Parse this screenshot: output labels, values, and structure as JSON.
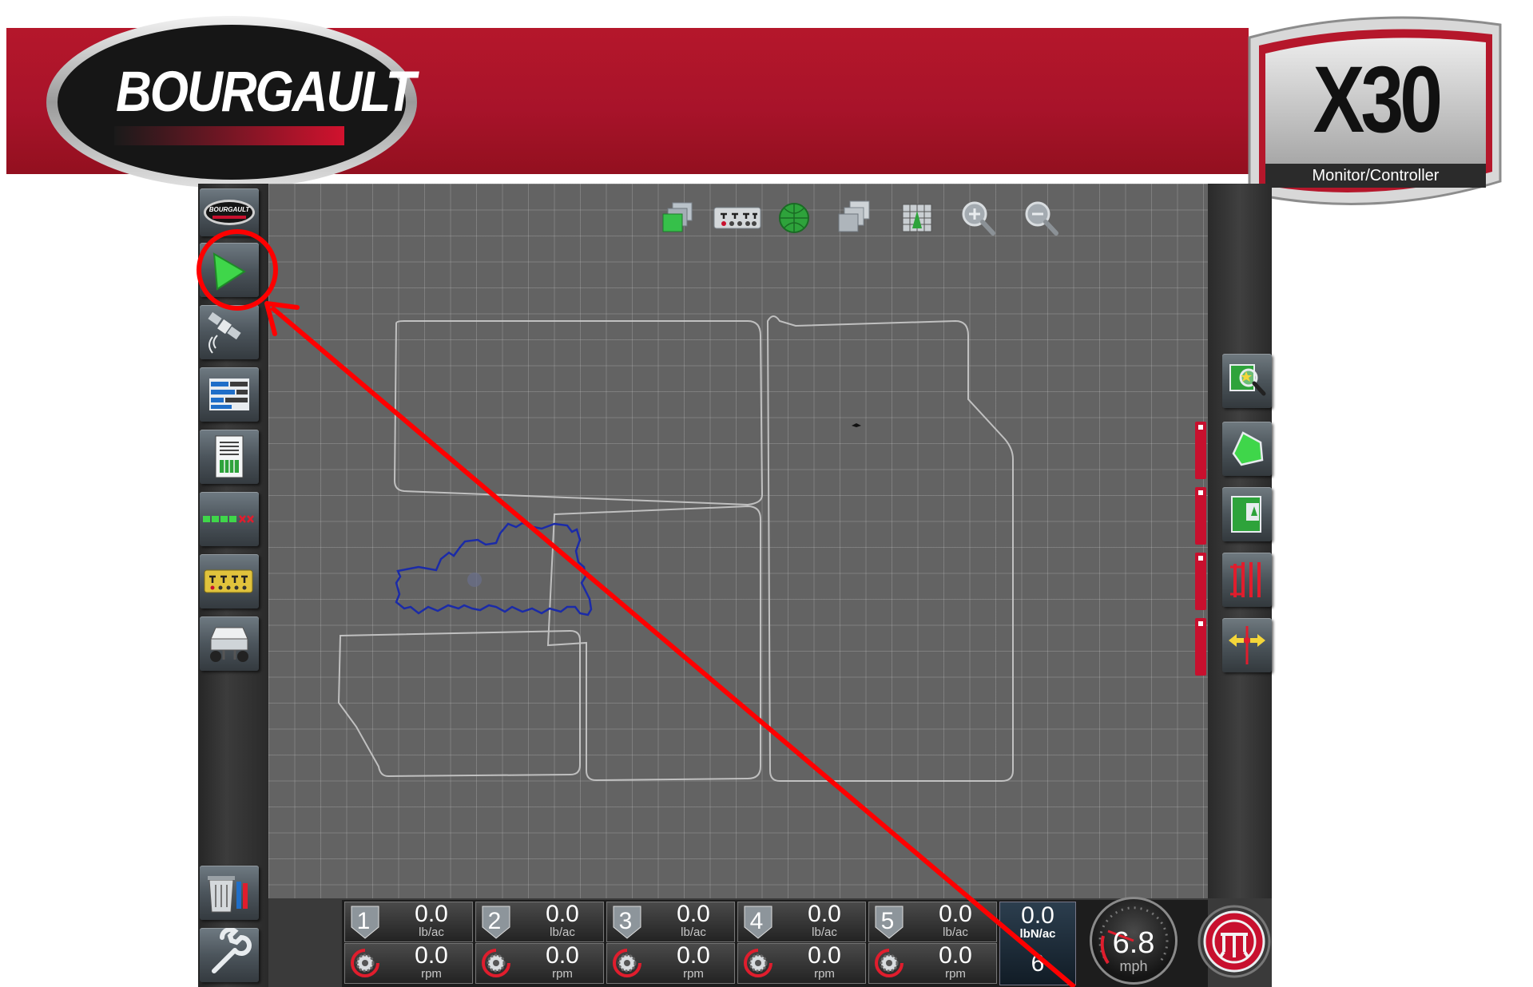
{
  "header": {
    "brand_logo_text": "BOURGAULT",
    "model_logo_text": "X30",
    "model_subtitle": "Monitor/Controller",
    "sidebar_logo_text": "BOURGAULT"
  },
  "colors": {
    "banner": "#a8132a",
    "accent_red": "#c8102e",
    "map_background": "#636363",
    "coverage_outline": "#1a2aa0",
    "highlight_red": "#ff0000"
  },
  "left_toolbar": [
    {
      "name": "bourgault-logo-button",
      "icon": "bourgault-badge-icon"
    },
    {
      "name": "guidance-button",
      "icon": "green-arrow-icon"
    },
    {
      "name": "gps-satellite-button",
      "icon": "satellite-icon"
    },
    {
      "name": "section-status-button",
      "icon": "bars-icon"
    },
    {
      "name": "reports-button",
      "icon": "document-icon"
    },
    {
      "name": "section-control-button",
      "icon": "section-boxes-icon"
    },
    {
      "name": "product-metering-button",
      "icon": "meter-rack-icon"
    },
    {
      "name": "tank-cart-button",
      "icon": "air-cart-icon"
    },
    {
      "name": "job-data-button",
      "icon": "trash-pencil-icon"
    },
    {
      "name": "settings-button",
      "icon": "wrench-icon"
    }
  ],
  "top_toolbar": [
    {
      "name": "layers-button",
      "icon": "layers-icon"
    },
    {
      "name": "implement-view-button",
      "icon": "implement-icon"
    },
    {
      "name": "globe-button",
      "icon": "globe-icon"
    },
    {
      "name": "map-stack-button",
      "icon": "stack-icon"
    },
    {
      "name": "field-view-button",
      "icon": "field-grid-icon"
    },
    {
      "name": "zoom-in-button",
      "icon": "zoom-in-icon"
    },
    {
      "name": "zoom-out-button",
      "icon": "zoom-out-icon"
    }
  ],
  "right_toolbar": [
    {
      "name": "field-explorer-button",
      "icon": "field-magnifier-icon"
    },
    {
      "name": "boundary-button",
      "icon": "green-boundary-icon"
    },
    {
      "name": "headland-button",
      "icon": "headland-icon"
    },
    {
      "name": "guidance-lines-button",
      "icon": "red-lines-icon"
    },
    {
      "name": "nudge-button",
      "icon": "nudge-arrows-icon"
    }
  ],
  "products": [
    {
      "id": "1",
      "rate": "0.0",
      "rate_unit": "lb/ac",
      "rpm": "0.0",
      "rpm_unit": "rpm"
    },
    {
      "id": "2",
      "rate": "0.0",
      "rate_unit": "lb/ac",
      "rpm": "0.0",
      "rpm_unit": "rpm"
    },
    {
      "id": "3",
      "rate": "0.0",
      "rate_unit": "lb/ac",
      "rpm": "0.0",
      "rpm_unit": "rpm"
    },
    {
      "id": "4",
      "rate": "0.0",
      "rate_unit": "lb/ac",
      "rpm": "0.0",
      "rpm_unit": "rpm"
    },
    {
      "id": "5",
      "rate": "0.0",
      "rate_unit": "lb/ac",
      "rpm": "0.0",
      "rpm_unit": "rpm"
    }
  ],
  "total": {
    "rate": "0.0",
    "unit": "lbN/ac",
    "partial": "6"
  },
  "speed": {
    "value": "6.8",
    "unit": "mph"
  }
}
